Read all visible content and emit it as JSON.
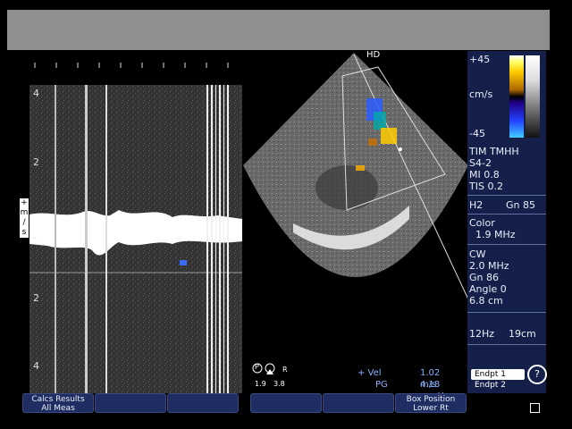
{
  "doppler": {
    "y_labels": [
      "4",
      "2",
      "-",
      "2",
      "4"
    ],
    "unit_label": [
      "+",
      "m",
      "/",
      "s"
    ]
  },
  "sector": {
    "mode_label": "HD"
  },
  "color_scale": {
    "top": "+45",
    "bottom": "-45",
    "unit": "cm/s"
  },
  "settings": {
    "line1": "TIM TMHH",
    "probe": "S4-2",
    "mi": "MI 0.8",
    "tis": "TIS 0.2",
    "harmonic": "H2",
    "gain": "Gn 85",
    "color_label": "Color",
    "color_freq": "1.9 MHz",
    "cw_label": "CW",
    "cw_freq": "2.0 MHz",
    "cw_gain": "Gn 86",
    "angle": "Angle 0",
    "depth": "6.8 cm",
    "frame_rate": "12Hz",
    "scan_depth": "19cm"
  },
  "measurements": {
    "vel_label": "+ Vel",
    "vel_value": "1.02 m/s",
    "pg_label": "PG",
    "pg_value": "4.18 mmHg"
  },
  "probe_indicator": {
    "p": "P",
    "r": "R",
    "left": "1.9",
    "right": "3.8"
  },
  "buttons": {
    "calcs_results": "Calcs Results",
    "all_meas": "All Meas",
    "box_position": "Box Position",
    "lower_rt": "Lower Rt",
    "endpt1": "Endpt 1",
    "endpt2": "Endpt 2"
  },
  "help_icon": "?"
}
